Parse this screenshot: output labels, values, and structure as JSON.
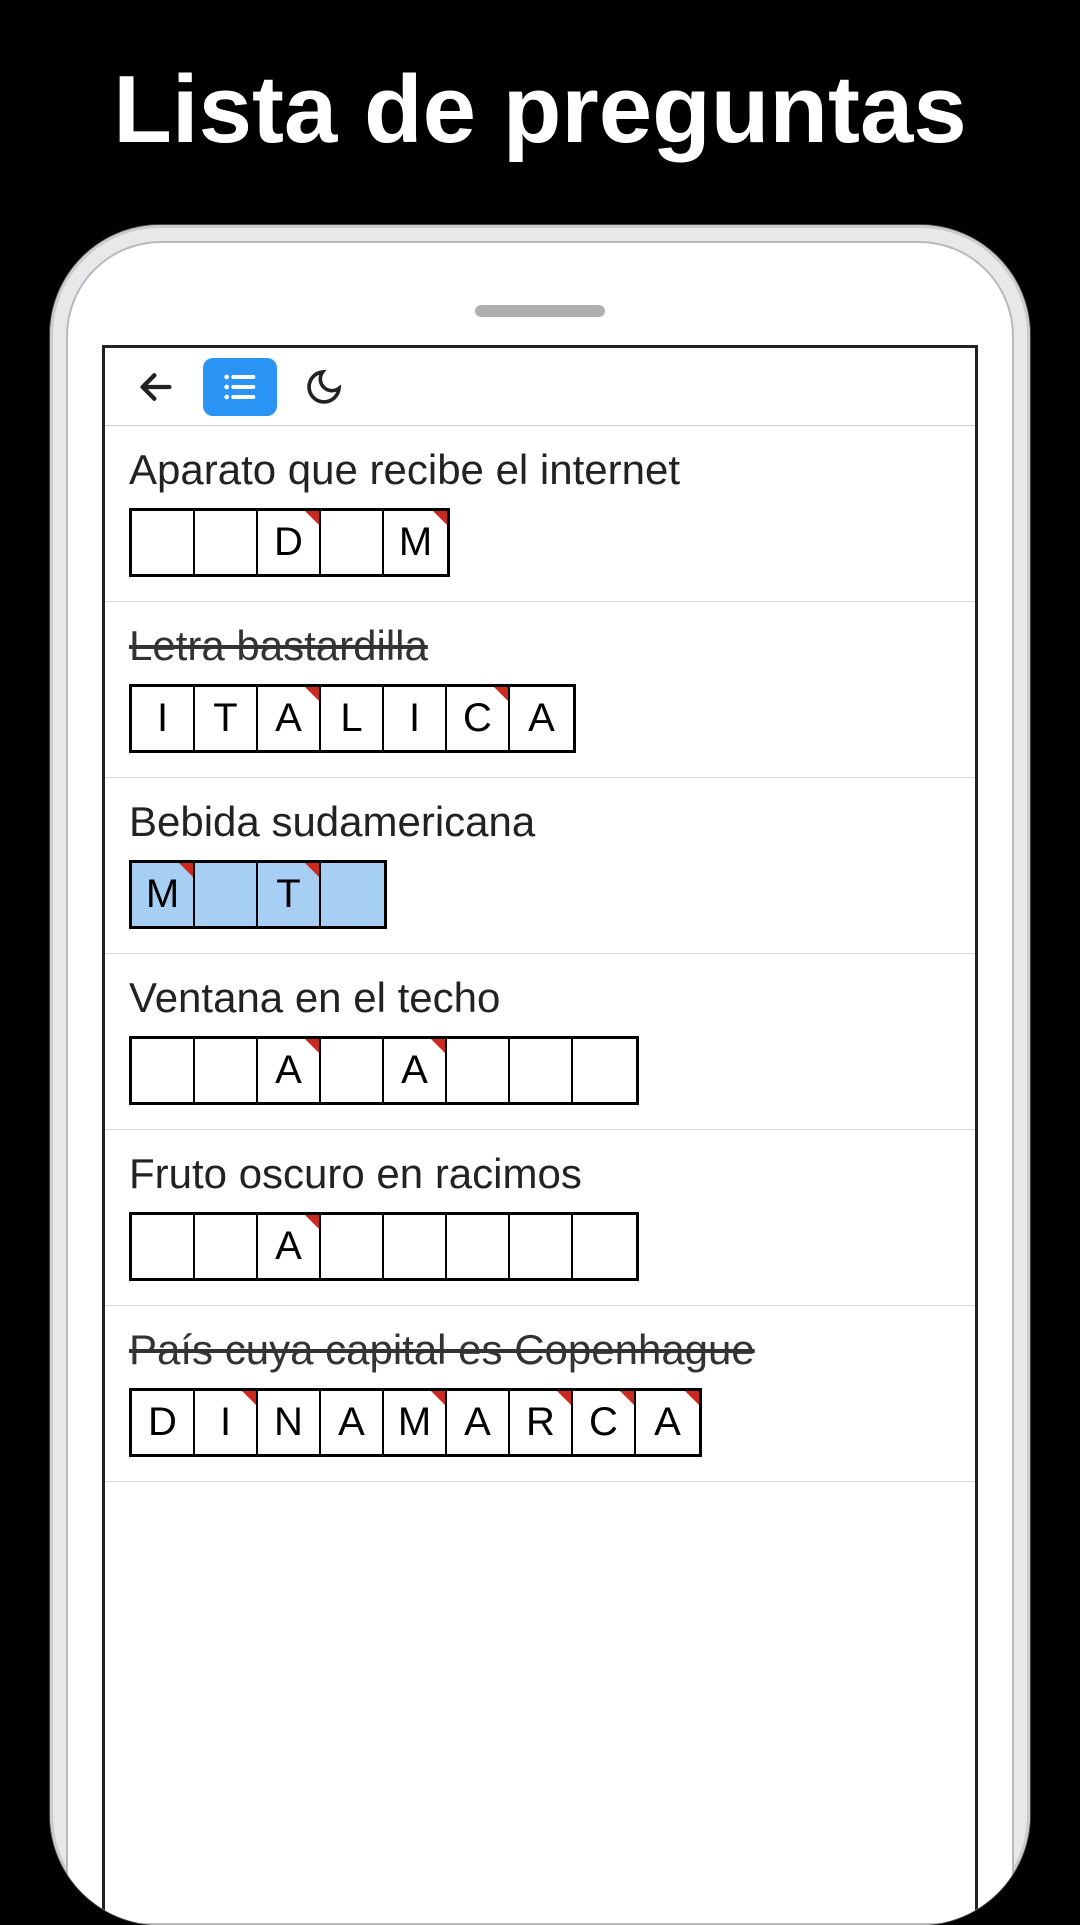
{
  "title": "Lista de preguntas",
  "clues": [
    {
      "text": "Aparato que recibe el internet",
      "solved": false,
      "highlighted": false,
      "cells": [
        {
          "letter": "",
          "hint": false
        },
        {
          "letter": "",
          "hint": false
        },
        {
          "letter": "D",
          "hint": true
        },
        {
          "letter": "",
          "hint": false
        },
        {
          "letter": "M",
          "hint": true
        }
      ]
    },
    {
      "text": "Letra bastardilla",
      "solved": true,
      "highlighted": false,
      "cells": [
        {
          "letter": "I",
          "hint": false
        },
        {
          "letter": "T",
          "hint": false
        },
        {
          "letter": "A",
          "hint": true
        },
        {
          "letter": "L",
          "hint": false
        },
        {
          "letter": "I",
          "hint": false
        },
        {
          "letter": "C",
          "hint": true
        },
        {
          "letter": "A",
          "hint": false
        }
      ]
    },
    {
      "text": "Bebida sudamericana",
      "solved": false,
      "highlighted": true,
      "cells": [
        {
          "letter": "M",
          "hint": true
        },
        {
          "letter": "",
          "hint": false
        },
        {
          "letter": "T",
          "hint": true
        },
        {
          "letter": "",
          "hint": false
        }
      ]
    },
    {
      "text": "Ventana en el techo",
      "solved": false,
      "highlighted": false,
      "cells": [
        {
          "letter": "",
          "hint": false
        },
        {
          "letter": "",
          "hint": false
        },
        {
          "letter": "A",
          "hint": true
        },
        {
          "letter": "",
          "hint": false
        },
        {
          "letter": "A",
          "hint": true
        },
        {
          "letter": "",
          "hint": false
        },
        {
          "letter": "",
          "hint": false
        },
        {
          "letter": "",
          "hint": false
        }
      ]
    },
    {
      "text": "Fruto oscuro en racimos",
      "solved": false,
      "highlighted": false,
      "cells": [
        {
          "letter": "",
          "hint": false
        },
        {
          "letter": "",
          "hint": false
        },
        {
          "letter": "A",
          "hint": true
        },
        {
          "letter": "",
          "hint": false
        },
        {
          "letter": "",
          "hint": false
        },
        {
          "letter": "",
          "hint": false
        },
        {
          "letter": "",
          "hint": false
        },
        {
          "letter": "",
          "hint": false
        }
      ]
    },
    {
      "text": "País cuya capital es Copenhague",
      "solved": true,
      "highlighted": false,
      "cells": [
        {
          "letter": "D",
          "hint": false
        },
        {
          "letter": "I",
          "hint": true
        },
        {
          "letter": "N",
          "hint": false
        },
        {
          "letter": "A",
          "hint": false
        },
        {
          "letter": "M",
          "hint": true
        },
        {
          "letter": "A",
          "hint": false
        },
        {
          "letter": "R",
          "hint": true
        },
        {
          "letter": "C",
          "hint": true
        },
        {
          "letter": "A",
          "hint": true
        }
      ]
    }
  ]
}
